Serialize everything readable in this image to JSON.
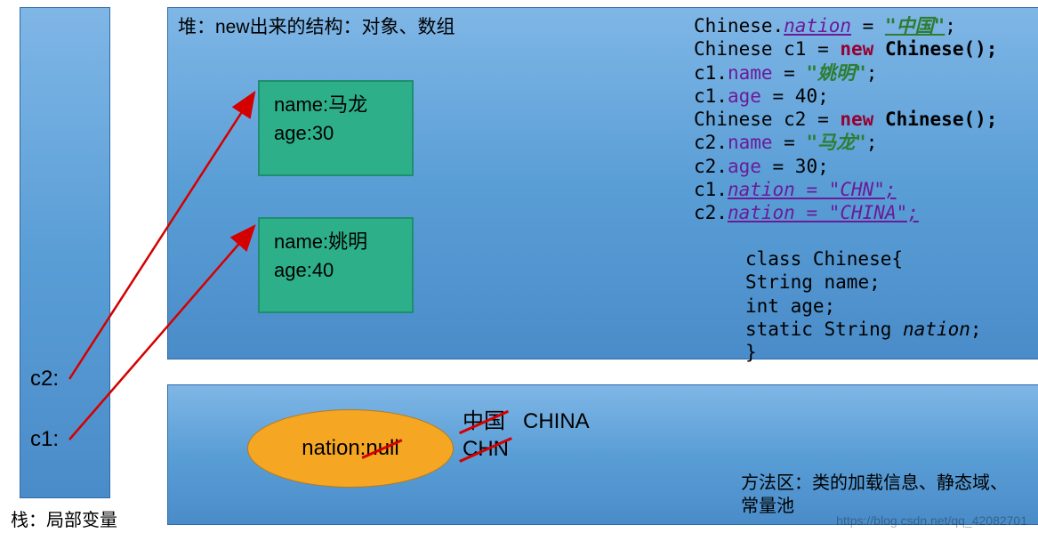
{
  "stack": {
    "caption": "栈：局部变量",
    "vars": {
      "c2": "c2:",
      "c1": "c1:"
    }
  },
  "heap": {
    "title": "堆：new出来的结构：对象、数组",
    "obj1": {
      "name_line": "name:马龙",
      "age_line": "age:30"
    },
    "obj2": {
      "name_line": "name:姚明",
      "age_line": "age:40"
    }
  },
  "method_area": {
    "caption": "方法区：类的加载信息、静态域、常量池",
    "nation_label": "nation:",
    "nation_initial": "null",
    "nation_val1": "中国",
    "nation_val2": "CHN",
    "nation_val3": "CHINA"
  },
  "code": {
    "l1": {
      "a": "Chinese.",
      "b": "nation",
      "c": " = ",
      "d": "\"中国\"",
      "e": ";"
    },
    "l2": {
      "a": "Chinese c1 = ",
      "b": "new",
      "c": " Chinese();"
    },
    "l3": {
      "a": "c1.",
      "b": "name",
      "c": " = ",
      "d": "\"姚明\"",
      "e": ";"
    },
    "l4": {
      "a": "c1.",
      "b": "age",
      "c": " = 40;"
    },
    "l5": {
      "a": "Chinese c2 = ",
      "b": "new",
      "c": " Chinese();"
    },
    "l6": {
      "a": "c2.",
      "b": "name",
      "c": " = ",
      "d": "\"马龙\"",
      "e": ";"
    },
    "l7": {
      "a": "c2.",
      "b": "age",
      "c": " = 30;"
    },
    "l8": {
      "a": "c1.",
      "b": "nation = \"CHN\";"
    },
    "l9": {
      "a": "c2.",
      "b": "nation  = \"CHINA\";"
    }
  },
  "classdef": {
    "l1a": "class",
    "l1b": " Chinese{",
    "l2a": "String ",
    "l2b": "name",
    "l2c": ";",
    "l3a": "int",
    "l3b": " age",
    "l3c": ";",
    "l4a": "static",
    "l4b": " String ",
    "l4c": "nation",
    "l4d": ";",
    "l5": "}"
  },
  "watermark": "https://blog.csdn.net/qq_42082701"
}
